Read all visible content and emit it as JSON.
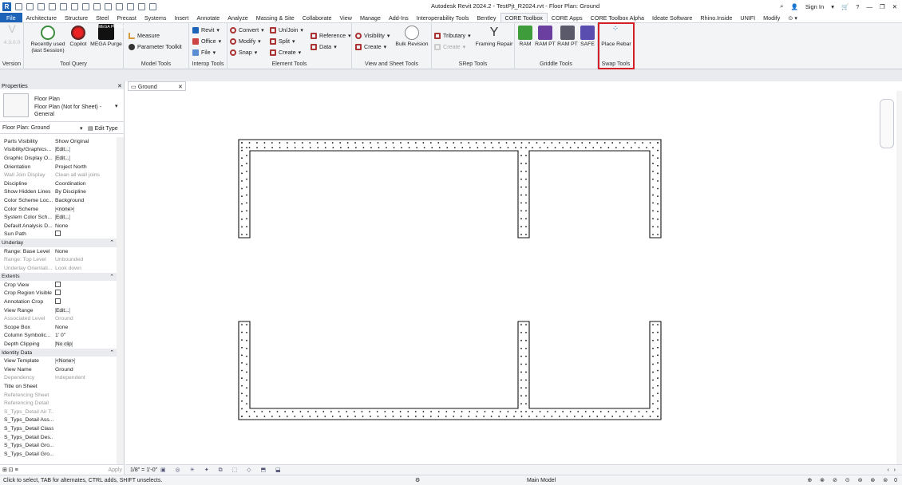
{
  "window": {
    "title": "Autodesk Revit 2024.2 - TestPjt_R2024.rvt - Floor Plan: Ground",
    "sign_in": "Sign In"
  },
  "tabs": [
    "File",
    "Architecture",
    "Structure",
    "Steel",
    "Precast",
    "Systems",
    "Insert",
    "Annotate",
    "Analyze",
    "Massing & Site",
    "Collaborate",
    "View",
    "Manage",
    "Add-Ins",
    "Interoperability Tools",
    "Bentley",
    "CORE Toolbox",
    "CORE Apps",
    "CORE Toolbox Alpha",
    "Ideate Software",
    "Rhino.Inside",
    "UNIFI",
    "Modify"
  ],
  "active_tab": "CORE Toolbox",
  "ribbon": {
    "version": {
      "label": "Version",
      "value": "4.3.0.0"
    },
    "tool_query": {
      "label": "Tool Query",
      "recent": "Recently used",
      "recent2": "(last Session)",
      "copilot": "Copilot",
      "mega": "MEGA Purge",
      "mega_logo": "MEGA PURGE"
    },
    "model_tools": {
      "label": "Model Tools",
      "measure": "Measure",
      "param": "Parameter Toolkit"
    },
    "interop": {
      "label": "Interop Tools",
      "revit": "Revit",
      "office": "Office",
      "file": "File"
    },
    "element": {
      "label": "Element Tools",
      "convert": "Convert",
      "modify": "Modify",
      "snap": "Snap",
      "unjoin": "Un/Join",
      "split": "Split",
      "create": "Create",
      "reference": "Reference",
      "data": "Data"
    },
    "view_sheet": {
      "label": "View and Sheet Tools",
      "visibility": "Visibility",
      "create": "Create",
      "bulk": "Bulk Revision"
    },
    "srep": {
      "label": "SRep Tools",
      "tributary": "Tributary",
      "create": "Create",
      "framing": "Framing Repair"
    },
    "griddle": {
      "label": "Griddle Tools",
      "ram": "RAM",
      "rampt1": "RAM PT",
      "rampt2": "RAM PT",
      "safe": "SAFE"
    },
    "swap": {
      "label": "Swap Tools",
      "place_rebar": "Place Rebar"
    }
  },
  "properties": {
    "title": "Properties",
    "type_line1": "Floor Plan",
    "type_line2": "Floor Plan (Not for Sheet) -",
    "type_line3": "General",
    "filter": "Floor Plan: Ground",
    "edit_type": "Edit Type",
    "rows": [
      {
        "k": "Parts Visibility",
        "v": "Show Original",
        "t": "text"
      },
      {
        "k": "Visibility/Graphics...",
        "v": "Edit...",
        "t": "btn"
      },
      {
        "k": "Graphic Display O...",
        "v": "Edit...",
        "t": "btn"
      },
      {
        "k": "Orientation",
        "v": "Project North",
        "t": "text"
      },
      {
        "k": "Wall Join Display",
        "v": "Clean all wall joins",
        "t": "grey"
      },
      {
        "k": "Discipline",
        "v": "Coordination",
        "t": "text"
      },
      {
        "k": "Show Hidden Lines",
        "v": "By Discipline",
        "t": "text"
      },
      {
        "k": "Color Scheme Loc...",
        "v": "Background",
        "t": "text"
      },
      {
        "k": "Color Scheme",
        "v": "<none>",
        "t": "btn"
      },
      {
        "k": "System Color Sch...",
        "v": "Edit...",
        "t": "btn"
      },
      {
        "k": "Default Analysis D...",
        "v": "None",
        "t": "text"
      },
      {
        "k": "Sun Path",
        "v": "",
        "t": "chk"
      },
      {
        "k": "Underlay",
        "v": "",
        "t": "grp"
      },
      {
        "k": "Range: Base Level",
        "v": "None",
        "t": "text"
      },
      {
        "k": "Range: Top Level",
        "v": "Unbounded",
        "t": "grey"
      },
      {
        "k": "Underlay Orientati...",
        "v": "Look down",
        "t": "grey"
      },
      {
        "k": "Extents",
        "v": "",
        "t": "grp"
      },
      {
        "k": "Crop View",
        "v": "",
        "t": "chk"
      },
      {
        "k": "Crop Region Visible",
        "v": "",
        "t": "chk"
      },
      {
        "k": "Annotation Crop",
        "v": "",
        "t": "chk"
      },
      {
        "k": "View Range",
        "v": "Edit...",
        "t": "btn"
      },
      {
        "k": "Associated Level",
        "v": "Ground",
        "t": "grey"
      },
      {
        "k": "Scope Box",
        "v": "None",
        "t": "text"
      },
      {
        "k": "Column Symbolic...",
        "v": "1' 0\"",
        "t": "text"
      },
      {
        "k": "Depth Clipping",
        "v": "No clip",
        "t": "btn"
      },
      {
        "k": "Identity Data",
        "v": "",
        "t": "grp"
      },
      {
        "k": "View Template",
        "v": "<None>",
        "t": "btn"
      },
      {
        "k": "View Name",
        "v": "Ground",
        "t": "text"
      },
      {
        "k": "Dependency",
        "v": "Independent",
        "t": "grey"
      },
      {
        "k": "Title on Sheet",
        "v": "",
        "t": "text"
      },
      {
        "k": "Referencing Sheet",
        "v": "",
        "t": "grey"
      },
      {
        "k": "Referencing Detail",
        "v": "",
        "t": "grey"
      },
      {
        "k": "S_Typs_Detail Air T...",
        "v": "",
        "t": "grey"
      },
      {
        "k": "S_Typs_Detail Ass...",
        "v": "",
        "t": "text"
      },
      {
        "k": "S_Typs_Detail Class",
        "v": "",
        "t": "text"
      },
      {
        "k": "S_Typs_Detail Des...",
        "v": "",
        "t": "text"
      },
      {
        "k": "S_Typs_Detail Gro...",
        "v": "",
        "t": "text"
      },
      {
        "k": "S_Typs_Detail Gro...",
        "v": "",
        "t": "text"
      }
    ],
    "apply": "Apply"
  },
  "view_tab": {
    "name": "Ground"
  },
  "view_bar": {
    "scale": "1/8\" = 1'-0\""
  },
  "status": {
    "hint": "Click to select, TAB for alternates, CTRL adds, SHIFT unselects.",
    "model": "Main Model",
    "filter_count": "0"
  },
  "colors": {
    "accent": "#1d63b8",
    "highlight": "#d51f26",
    "ram_green": "#3f9c3a",
    "rampt_purple": "#6b3fa0"
  }
}
